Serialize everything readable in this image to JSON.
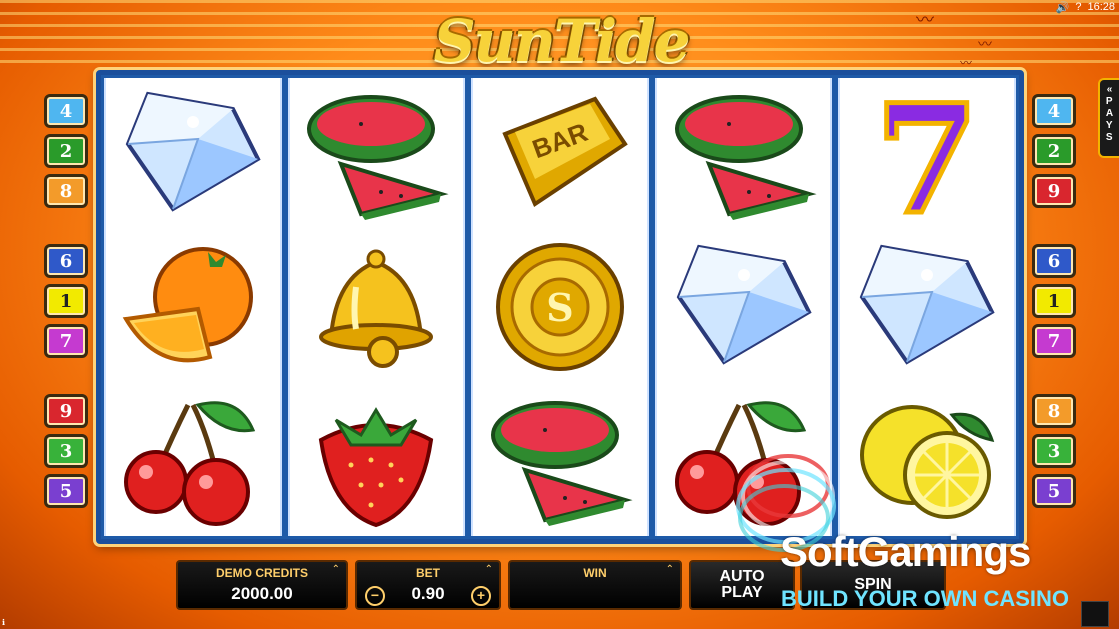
{
  "status_bar": {
    "volume_icon": "speaker-icon",
    "help_icon": "?",
    "time": "16:28"
  },
  "logo": {
    "text": "SunTide"
  },
  "paylines_left": [
    "4",
    "2",
    "8",
    "6",
    "1",
    "7",
    "9",
    "3",
    "5"
  ],
  "paylines_right": [
    "4",
    "2",
    "9",
    "6",
    "1",
    "7",
    "8",
    "3",
    "5"
  ],
  "payline_colors": {
    "1": "#f2ea00",
    "2": "#2a9b2a",
    "3": "#38b23a",
    "4": "#4fb6f0",
    "5": "#7a3fd0",
    "6": "#2f59c9",
    "7": "#c53ad0",
    "8": "#f39b2a",
    "9": "#d9262e"
  },
  "pays_tab": {
    "arrow": "«",
    "label": "PAYS"
  },
  "reels": [
    [
      "diamond",
      "orange",
      "cherries"
    ],
    [
      "watermelon",
      "bell",
      "strawberry"
    ],
    [
      "bar",
      "gold-coin",
      "watermelon"
    ],
    [
      "watermelon",
      "diamond",
      "cherries"
    ],
    [
      "seven",
      "diamond",
      "lemon"
    ]
  ],
  "symbols": {
    "bar_text": "BAR",
    "coin_text": "S",
    "seven_text": "7"
  },
  "controls": {
    "credits_label": "DEMO CREDITS",
    "credits_value": "2000.00",
    "bet_label": "BET",
    "bet_value": "0.90",
    "bet_minus": "−",
    "bet_plus": "+",
    "win_label": "WIN",
    "win_value": "",
    "autoplay_label_1": "AUTO",
    "autoplay_label_2": "PLAY",
    "spin_label": "SPIN",
    "chevron": "⌃"
  },
  "watermark": {
    "brand": "SoftGamings",
    "tagline": "BUILD YOUR OWN CASINO"
  }
}
